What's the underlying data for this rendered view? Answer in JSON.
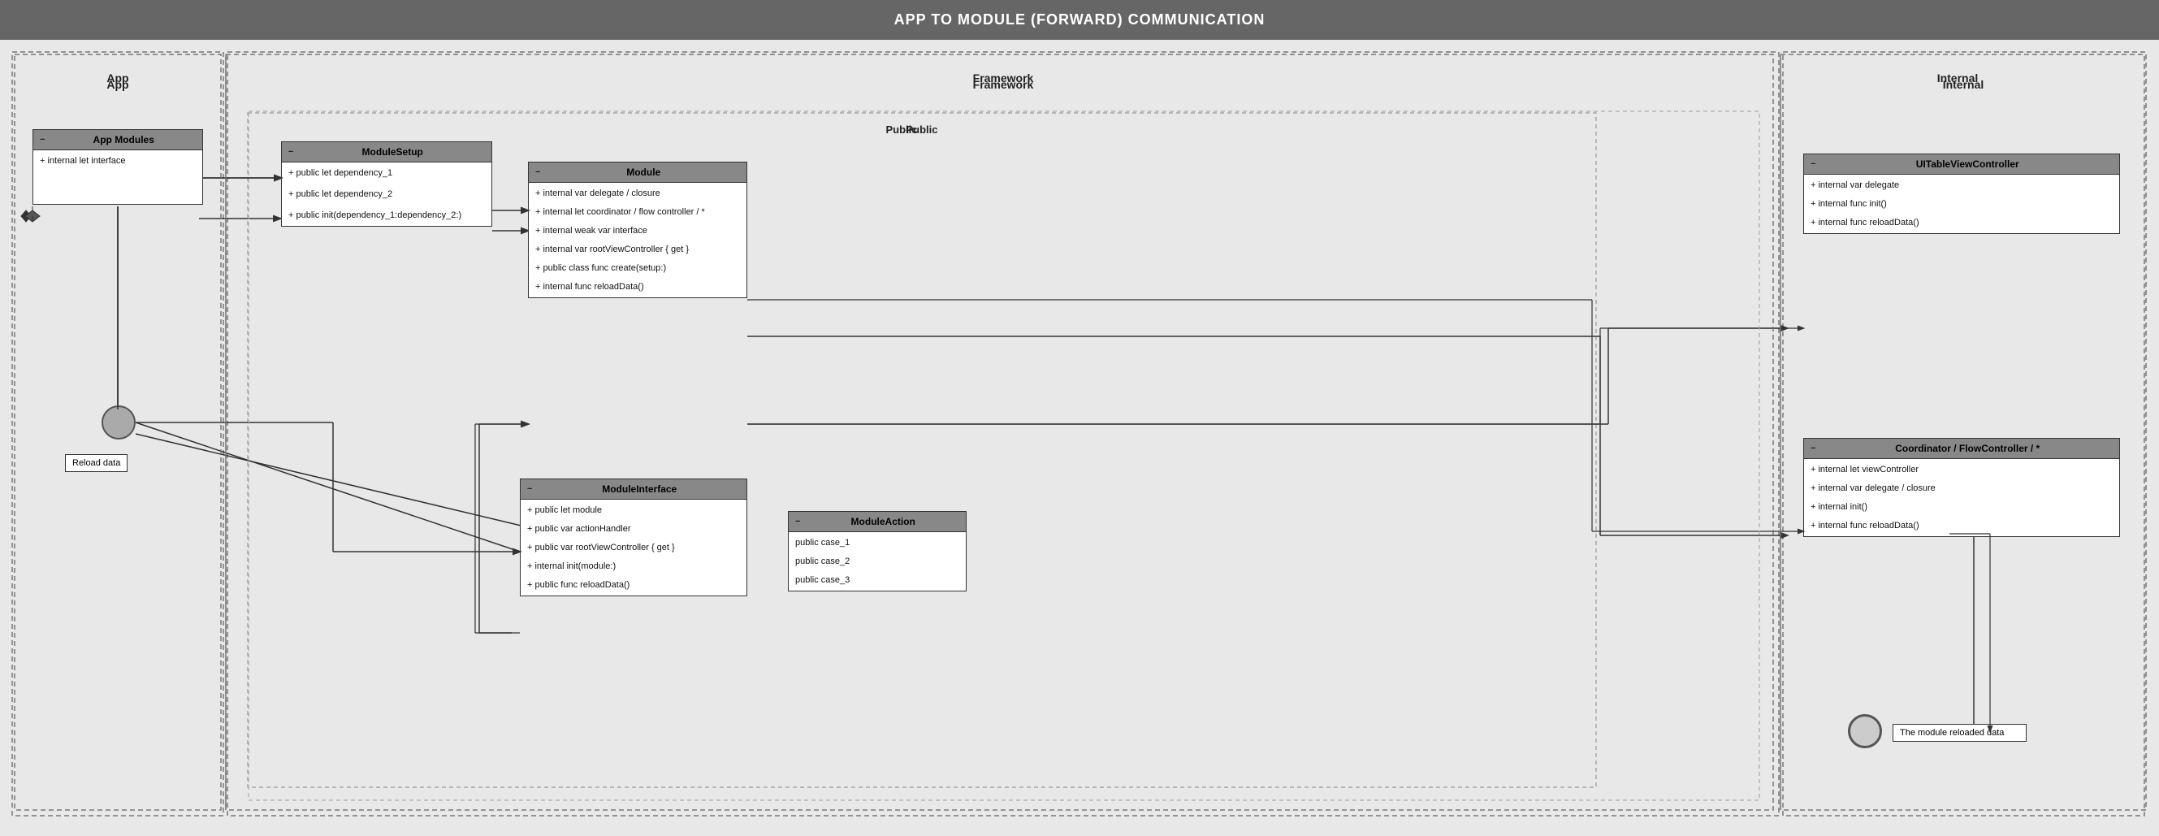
{
  "title": "APP TO MODULE (FORWARD) COMMUNICATION",
  "sections": {
    "app": {
      "label": "App",
      "appModules": {
        "header": "App Modules",
        "rows": [
          "+ internal let interface"
        ]
      },
      "circleNode": "filled",
      "reloadLabel": "Reload data"
    },
    "framework": {
      "label": "Framework",
      "publicLabel": "Public",
      "moduleSetup": {
        "header": "ModuleSetup",
        "rows": [
          "+ public let dependency_1",
          "+ public let dependency_2",
          "+ public init(dependency_1:dependency_2:)"
        ]
      },
      "module": {
        "header": "Module",
        "rows": [
          "+ internal var delegate / closure",
          "+ internal let coordinator / flow controller / *",
          "+ internal weak var interface",
          "+ internal var rootViewController { get }",
          "+ public class func create(setup:)",
          "+ internal func reloadData()"
        ]
      },
      "moduleInterface": {
        "header": "ModuleInterface",
        "rows": [
          "+ public let module",
          "+ public var actionHandler",
          "+ public var rootViewController { get }",
          "+ internal init(module:)",
          "+ public func reloadData()"
        ]
      },
      "moduleAction": {
        "header": "ModuleAction",
        "rows": [
          "public case_1",
          "public case_2",
          "public case_3"
        ]
      }
    },
    "internal": {
      "label": "Internal",
      "uiTableViewController": {
        "header": "UITableViewController",
        "rows": [
          "+ internal var delegate",
          "+ internal func init()",
          "+ internal func reloadData()"
        ]
      },
      "coordinator": {
        "header": "Coordinator / FlowController / *",
        "rows": [
          "+ internal let viewController",
          "+ internal var delegate / closure",
          "+ internal init()",
          "+ internal func reloadData()"
        ]
      },
      "circleNodeOutline": "outline",
      "reloadLabel": "The module reloaded data"
    }
  }
}
